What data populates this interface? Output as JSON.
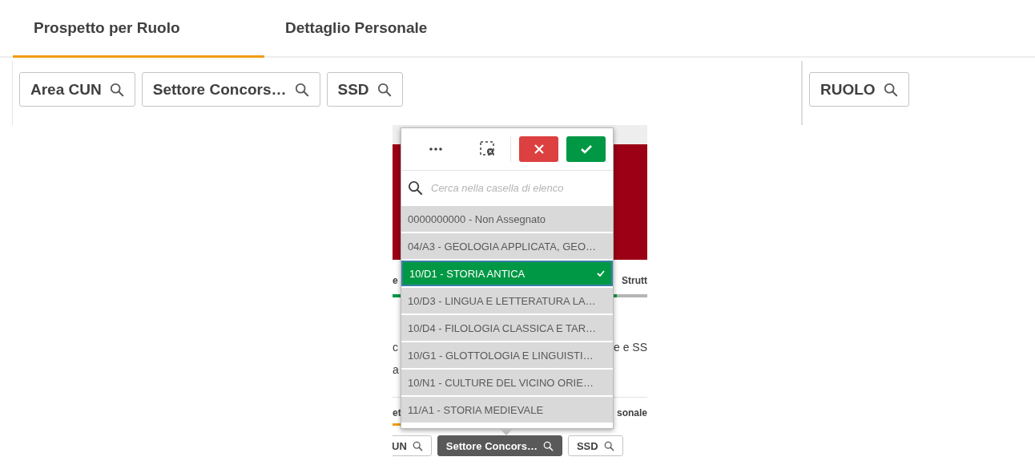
{
  "tabs": [
    {
      "label": "Prospetto per Ruolo",
      "selected": true
    },
    {
      "label": "Dettaglio Personale",
      "selected": false
    }
  ],
  "filters": [
    {
      "label": "Area CUN"
    },
    {
      "label": "Settore Concors…"
    },
    {
      "label": "SSD"
    }
  ],
  "right_filters": [
    {
      "label": "RUOLO"
    }
  ],
  "inset": {
    "bar": {
      "level": 0.88
    },
    "background_rows": [
      {
        "left": "e",
        "right": "Strutt"
      },
      {
        "left": "c",
        "right": "e e SS"
      },
      {
        "left": "a"
      }
    ],
    "tab_fragments": [
      {
        "label": "et",
        "selected": true
      },
      {
        "label": "sonale",
        "selected": false
      }
    ],
    "filters": [
      {
        "label": "UN",
        "selected": false
      },
      {
        "label": "Settore Concors…",
        "selected": true
      },
      {
        "label": "SSD",
        "selected": false
      }
    ]
  },
  "listbox": {
    "search": {
      "placeholder": "Cerca nella casella di elenco"
    },
    "items": [
      {
        "label": "0000000000 - Non Assegnato",
        "selected": false
      },
      {
        "label": "04/A3 - GEOLOGIA APPLICATA, GEO…",
        "selected": false
      },
      {
        "label": "10/D1 - STORIA ANTICA",
        "selected": true
      },
      {
        "label": "10/D3 - LINGUA E LETTERATURA LA…",
        "selected": false
      },
      {
        "label": "10/D4 - FILOLOGIA CLASSICA E TAR…",
        "selected": false
      },
      {
        "label": "10/G1 - GLOTTOLOGIA E LINGUISTI…",
        "selected": false
      },
      {
        "label": "10/N1 - CULTURE DEL VICINO ORIE…",
        "selected": false
      },
      {
        "label": "11/A1 - STORIA MEDIEVALE",
        "selected": false
      }
    ]
  }
}
